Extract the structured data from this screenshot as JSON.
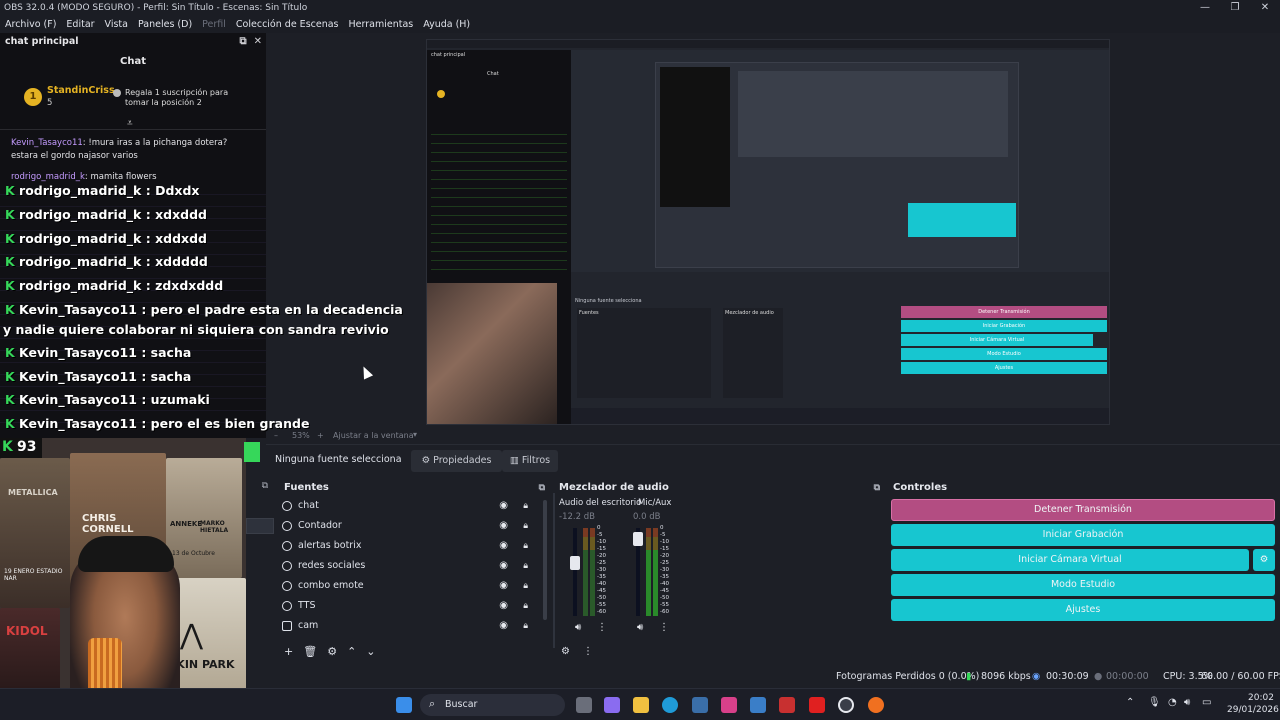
{
  "window": {
    "title": "OBS 32.0.4 (MODO SEGURO) - Perfil: Sin Título - Escenas: Sin Título",
    "controls": [
      "—",
      "❐",
      "✕"
    ]
  },
  "menu": [
    "Archivo (F)",
    "Editar",
    "Vista",
    "Paneles (D)",
    "Perfil",
    "Colección de Escenas",
    "Herramientas",
    "Ayuda (H)"
  ],
  "chat_dock": {
    "title": "chat principal",
    "header": "Chat",
    "pinned": {
      "user": "StandinCriss",
      "count": "5",
      "message": "Regala 1 suscripción para tomar la posición 2",
      "rank": "1"
    },
    "lines": [
      {
        "user": "Kevin_Tasayco11",
        "text": "!mura iras a la pichanga dotera? estara el gordo najasor varios"
      },
      {
        "user": "rodrigo_madrid_k",
        "text": "mamita flowers"
      }
    ],
    "overlay_lines": [
      {
        "user": "rodrigo_madrid_k",
        "text": "Ddxdx"
      },
      {
        "user": "rodrigo_madrid_k",
        "text": "xdxddd"
      },
      {
        "user": "rodrigo_madrid_k",
        "text": "xddxdd"
      },
      {
        "user": "rodrigo_madrid_k",
        "text": "xddddd"
      },
      {
        "user": "rodrigo_madrid_k",
        "text": "zdxdxddd"
      },
      {
        "user": "Kevin_Tasayco11",
        "text": "pero el padre esta en la decadencia"
      },
      {
        "user": "",
        "text": "y nadie quiere colaborar ni siquiera con sandra revivio"
      },
      {
        "user": "Kevin_Tasayco11",
        "text": "sacha"
      },
      {
        "user": "Kevin_Tasayco11",
        "text": "sacha"
      },
      {
        "user": "Kevin_Tasayco11",
        "text": "uzumaki"
      },
      {
        "user": "Kevin_Tasayco11",
        "text": "pero el es bien grande"
      }
    ],
    "viewer_count": "93"
  },
  "webcam": {
    "poster_texts": [
      "METALLICA",
      "CHRIS CORNELL",
      "ANNEKE",
      "MARKO HIETALA",
      "13 de Octubre",
      "LINKIN PARK",
      "KIDOL",
      "19 ENERO ESTADIO NAR"
    ]
  },
  "zoom": {
    "minus": "–",
    "value": "53%",
    "plus": "+",
    "fit": "Ajustar a la ventana"
  },
  "source_bar": {
    "none": "Ninguna fuente selecciona",
    "properties": "Propiedades",
    "filters": "Filtros"
  },
  "sources": {
    "title": "Fuentes",
    "items": [
      "chat",
      "Contador",
      "alertas botrix",
      "redes sociales",
      "combo emote",
      "TTS",
      "cam"
    ]
  },
  "mixer": {
    "title": "Mezclador de audio",
    "channels": [
      {
        "name": "Audio del escritorio",
        "db": "-12.2 dB",
        "level": 0.62
      },
      {
        "name": "Mic/Aux",
        "db": "0.0 dB",
        "level": 0.95
      }
    ],
    "scale": [
      "0",
      "-5",
      "-10",
      "-15",
      "-20",
      "-25",
      "-30",
      "-35",
      "-40",
      "-45",
      "-50",
      "-55",
      "-60"
    ]
  },
  "controls": {
    "title": "Controles",
    "stop_stream": "Detener Transmisión",
    "start_record": "Iniciar Grabación",
    "start_vcam": "Iniciar Cámara Virtual",
    "studio": "Modo Estudio",
    "settings": "Ajustes"
  },
  "status": {
    "dropped": "Fotogramas Perdidos 0 (0.0%)",
    "bitrate": "8096 kbps",
    "live": "00:30:09",
    "rec": "00:00:00",
    "cpu": "CPU: 3.5%",
    "fps": "60.00 / 60.00 FPS"
  },
  "taskbar": {
    "search": "Buscar",
    "time": "20:02",
    "date": "29/01/2026"
  },
  "colors": {
    "accent": "#17c6d0",
    "stop": "#b34d82",
    "bg": "#1d1f26"
  }
}
